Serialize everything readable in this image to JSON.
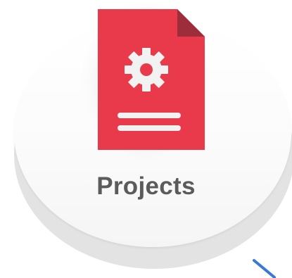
{
  "tile": {
    "label": "Projects",
    "icon": "document-gear-icon",
    "accent_color": "#e93a4c",
    "fold_color": "#9e2d3c",
    "gear_color": "#f2f2f2"
  },
  "scroll_hint": {
    "icon": "diagonal-line-icon",
    "color": "#3a78d6"
  }
}
